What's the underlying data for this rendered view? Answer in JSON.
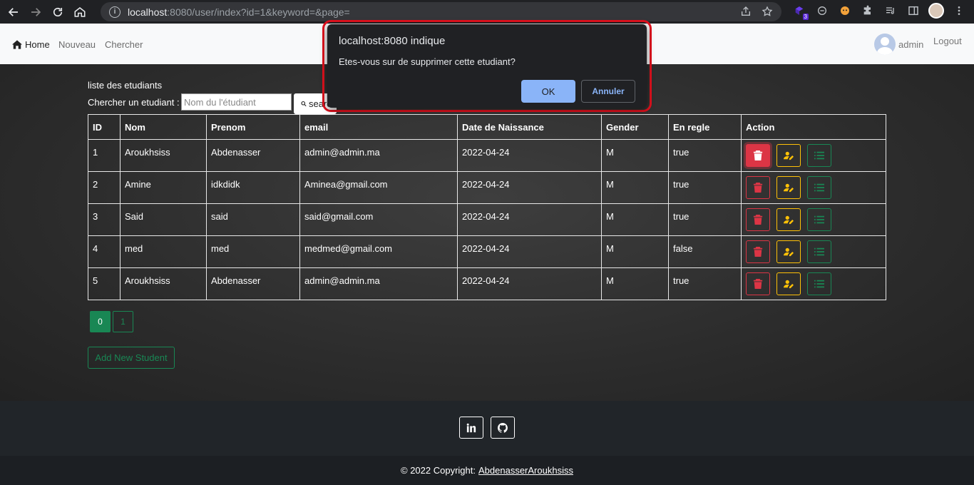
{
  "browser": {
    "url_host": "localhost",
    "url_rest": ":8080/user/index?id=1&keyword=&page=",
    "extension_badge": "3"
  },
  "navbar": {
    "home_label": "Home",
    "new_label": "Nouveau",
    "search_label": "Chercher",
    "user_label": "admin",
    "logout_label": "Logout"
  },
  "main": {
    "list_title": "liste des etudiants",
    "search_label": "Chercher un etudiant :",
    "search_placeholder": "Nom du l'étudiant",
    "search_button": "search",
    "add_button": "Add New Student"
  },
  "table": {
    "headers": [
      "ID",
      "Nom",
      "Prenom",
      "email",
      "Date de Naissance",
      "Gender",
      "En regle",
      "Action"
    ],
    "rows": [
      {
        "id": "1",
        "nom": "Aroukhsiss",
        "prenom": "Abdenasser",
        "email": "admin@admin.ma",
        "dob": "2022-04-24",
        "gender": "M",
        "en_regle": "true"
      },
      {
        "id": "2",
        "nom": "Amine",
        "prenom": "idkdidk",
        "email": "Aminea@gmail.com",
        "dob": "2022-04-24",
        "gender": "M",
        "en_regle": "true"
      },
      {
        "id": "3",
        "nom": "Said",
        "prenom": "said",
        "email": "said@gmail.com",
        "dob": "2022-04-24",
        "gender": "M",
        "en_regle": "true"
      },
      {
        "id": "4",
        "nom": "med",
        "prenom": "med",
        "email": "medmed@gmail.com",
        "dob": "2022-04-24",
        "gender": "M",
        "en_regle": "false"
      },
      {
        "id": "5",
        "nom": "Aroukhsiss",
        "prenom": "Abdenasser",
        "email": "admin@admin.ma",
        "dob": "2022-04-24",
        "gender": "M",
        "en_regle": "true"
      }
    ]
  },
  "pagination": {
    "pages": [
      "0",
      "1"
    ],
    "current": "0"
  },
  "footer": {
    "copyright": "© 2022 Copyright:",
    "author_link": "AbdenasserAroukhsiss"
  },
  "dialog": {
    "title": "localhost:8080 indique",
    "message": "Etes-vous sur de supprimer cette etudiant?",
    "ok_label": "OK",
    "cancel_label": "Annuler"
  },
  "colors": {
    "danger": "#dc3545",
    "warning": "#ffc107",
    "success": "#198754",
    "dialog_primary": "#8ab4f8",
    "highlight_outline": "#e3111e"
  }
}
